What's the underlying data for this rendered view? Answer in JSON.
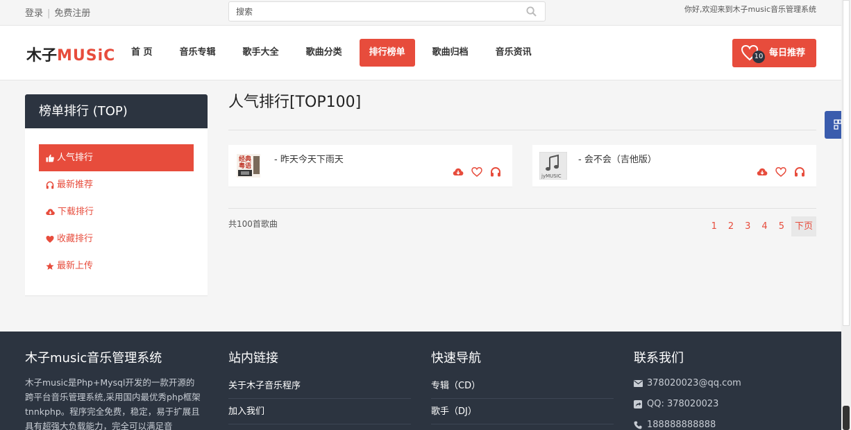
{
  "topbar": {
    "login": "登录",
    "separator": "|",
    "register": "免费注册",
    "search_placeholder": "搜索",
    "welcome": "你好,欢迎来到木子music音乐管理系统"
  },
  "logo": {
    "cn": "木子",
    "en": "MUSiC"
  },
  "nav": {
    "items": [
      "首 页",
      "音乐专辑",
      "歌手大全",
      "歌曲分类",
      "排行榜单",
      "歌曲归档",
      "音乐资讯"
    ],
    "active": "排行榜单",
    "daily_badge": "10",
    "daily_label": "每日推荐"
  },
  "sidebar": {
    "title": "榜单排行 (TOP)",
    "items": [
      {
        "label": "人气排行",
        "icon": "thumbs-up-icon",
        "active": true
      },
      {
        "label": "最新推荐",
        "icon": "headphones-icon"
      },
      {
        "label": "下载排行",
        "icon": "cloud-download-icon"
      },
      {
        "label": "收藏排行",
        "icon": "heart-icon"
      },
      {
        "label": "最新上传",
        "icon": "star-icon"
      }
    ]
  },
  "main": {
    "title": "人气排行[TOP100]",
    "songs": [
      {
        "name": "- 昨天今天下雨天",
        "cover_text": "经典粤语"
      },
      {
        "name": "- 会不会（吉他版）",
        "cover_text": "jyMUSIC"
      }
    ],
    "count": "共100首歌曲",
    "pages": [
      "1",
      "2",
      "3",
      "4",
      "5"
    ],
    "next": "下页"
  },
  "footer": {
    "about_title": "木子music音乐管理系统",
    "about_text": "木子music是Php+Mysql开发的一款开源的跨平台音乐管理系统,采用国内最优秀php框架tnnkphp。程序完全免费，稳定，易于扩展且具有超强大负载能力，完全可以满足音",
    "links_title": "站内链接",
    "links": [
      "关于木子音乐程序",
      "加入我们"
    ],
    "nav_title": "快速导航",
    "nav_links": [
      "专辑（CD）",
      "歌手（DJ）"
    ],
    "contact_title": "联系我们",
    "email": "378020023@qq.com",
    "qq": "QQ: 378020023",
    "phone": "188888888888"
  },
  "colors": {
    "accent": "#e74c3c",
    "dark": "#2c3440"
  }
}
